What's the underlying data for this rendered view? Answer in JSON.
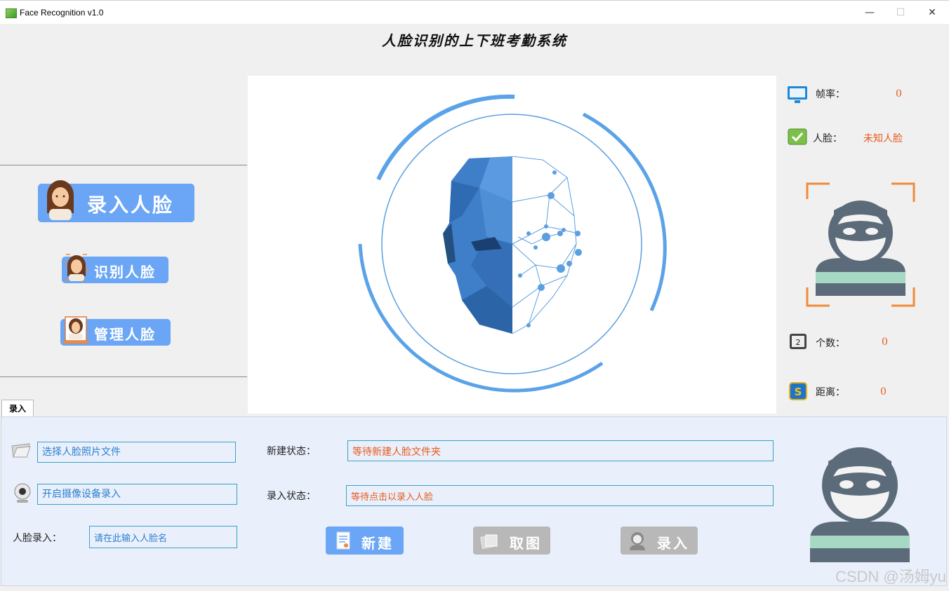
{
  "window": {
    "title": "Face Recognition v1.0",
    "minimize": "—",
    "maximize": "☐",
    "close": "✕"
  },
  "app_title": "人脸识别的上下班考勤系统",
  "sidebar": {
    "enroll_face": "录入人脸",
    "recognize_face": "识别人脸",
    "manage_face": "管理人脸"
  },
  "stats": {
    "fps_label": "帧率：",
    "fps_value": "0",
    "face_label": "人脸：",
    "face_value": "未知人脸",
    "count_label": "个数：",
    "count_value": "0",
    "distance_label": "距离：",
    "distance_value": "0"
  },
  "tab": {
    "label": "录入"
  },
  "enroll": {
    "select_photo": "选择人脸照片文件",
    "open_camera": "开启摄像设备录入",
    "name_label": "人脸录入：",
    "name_placeholder": "请在此输入人脸名",
    "new_status_label": "新建状态：",
    "new_status_value": "等待新建人脸文件夹",
    "enroll_status_label": "录入状态：",
    "enroll_status_value": "等待点击以录入人脸",
    "new_button": "新建",
    "capture_button": "取图",
    "enroll_button": "录入"
  },
  "watermark": "CSDN @汤姆yu",
  "colors": {
    "accent": "#6aa6f5",
    "status": "#e65a1e",
    "disabled": "#b8b8b8",
    "field_border": "#3aa0c8"
  }
}
